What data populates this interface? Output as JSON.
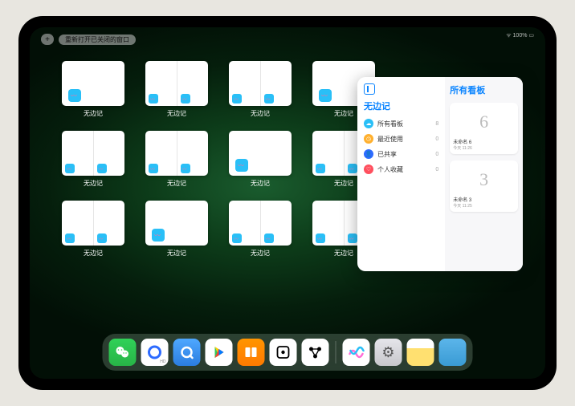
{
  "topbar": {
    "newtab": "+",
    "pill": "重新打开已关闭的窗口"
  },
  "status": "100%",
  "windows": [
    {
      "label": "无边记",
      "variant": "small-note"
    },
    {
      "label": "无边记",
      "variant": "two-panel"
    },
    {
      "label": "无边记",
      "variant": "two-panel"
    },
    {
      "label": "无边记",
      "variant": "small-note"
    },
    {
      "label": "无边记",
      "variant": "two-panel"
    },
    {
      "label": "无边记",
      "variant": "two-panel"
    },
    {
      "label": "无边记",
      "variant": "small-note"
    },
    {
      "label": "无边记",
      "variant": "two-panel"
    },
    {
      "label": "无边记",
      "variant": "two-panel"
    },
    {
      "label": "无边记",
      "variant": "small-note"
    },
    {
      "label": "无边记",
      "variant": "two-panel"
    },
    {
      "label": "无边记",
      "variant": "two-panel"
    }
  ],
  "panel": {
    "left_title": "无边记",
    "items": [
      {
        "color": "#29bff7",
        "glyph": "☁",
        "label": "所有看板",
        "count": "8"
      },
      {
        "color": "#ffb02e",
        "glyph": "◷",
        "label": "最近使用",
        "count": "0"
      },
      {
        "color": "#2d6bff",
        "glyph": "👤",
        "label": "已共享",
        "count": "0"
      },
      {
        "color": "#ff4f5e",
        "glyph": "♡",
        "label": "个人收藏",
        "count": "0"
      }
    ],
    "right_title": "所有看板",
    "boards": [
      {
        "glyph": "6",
        "label": "未命名 6",
        "sub": "今天 11:26"
      },
      {
        "glyph": "3",
        "label": "未命名 3",
        "sub": "今天 11:25"
      }
    ]
  },
  "dock": [
    {
      "name": "wechat",
      "glyph": "✿"
    },
    {
      "name": "quark-hd",
      "glyph": "◯"
    },
    {
      "name": "quark",
      "glyph": "Q"
    },
    {
      "name": "play",
      "glyph": "▶"
    },
    {
      "name": "books",
      "glyph": "▮▮"
    },
    {
      "name": "dice",
      "glyph": "⊡"
    },
    {
      "name": "nodes",
      "glyph": "⦿⦿"
    },
    {
      "name": "freeform",
      "glyph": "〰"
    },
    {
      "name": "settings",
      "glyph": "⚙"
    },
    {
      "name": "notes",
      "glyph": ""
    },
    {
      "name": "app-folder",
      "glyph": ""
    }
  ]
}
